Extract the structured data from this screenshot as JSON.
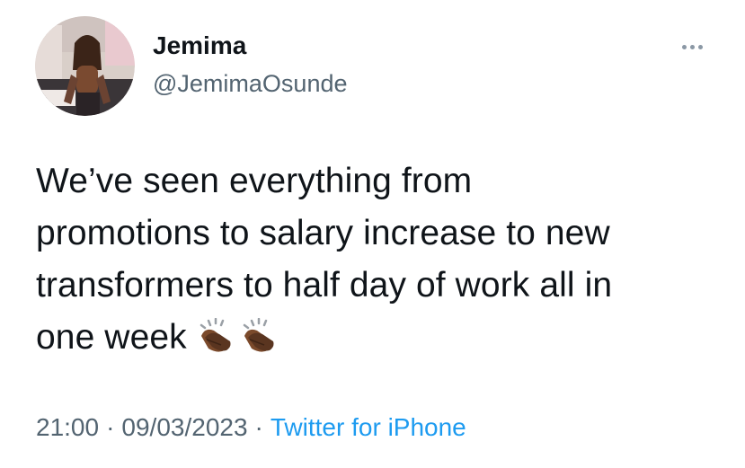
{
  "tweet": {
    "author": {
      "display_name": "Jemima",
      "handle": "@JemimaOsunde"
    },
    "more_icon": "ellipsis-icon",
    "body_lines": [
      "We’ve seen everything from",
      "promotions to salary increase to new",
      "transformers to half day of work all in",
      "one week"
    ],
    "emoji": [
      "clapping-hands-emoji",
      "clapping-hands-emoji"
    ],
    "meta": {
      "time": "21:00",
      "separator": "·",
      "date": "09/03/2023",
      "source": "Twitter for iPhone"
    }
  },
  "colors": {
    "text": "#0f1419",
    "secondary": "#536471",
    "link": "#1d9bf0",
    "background": "#ffffff"
  }
}
